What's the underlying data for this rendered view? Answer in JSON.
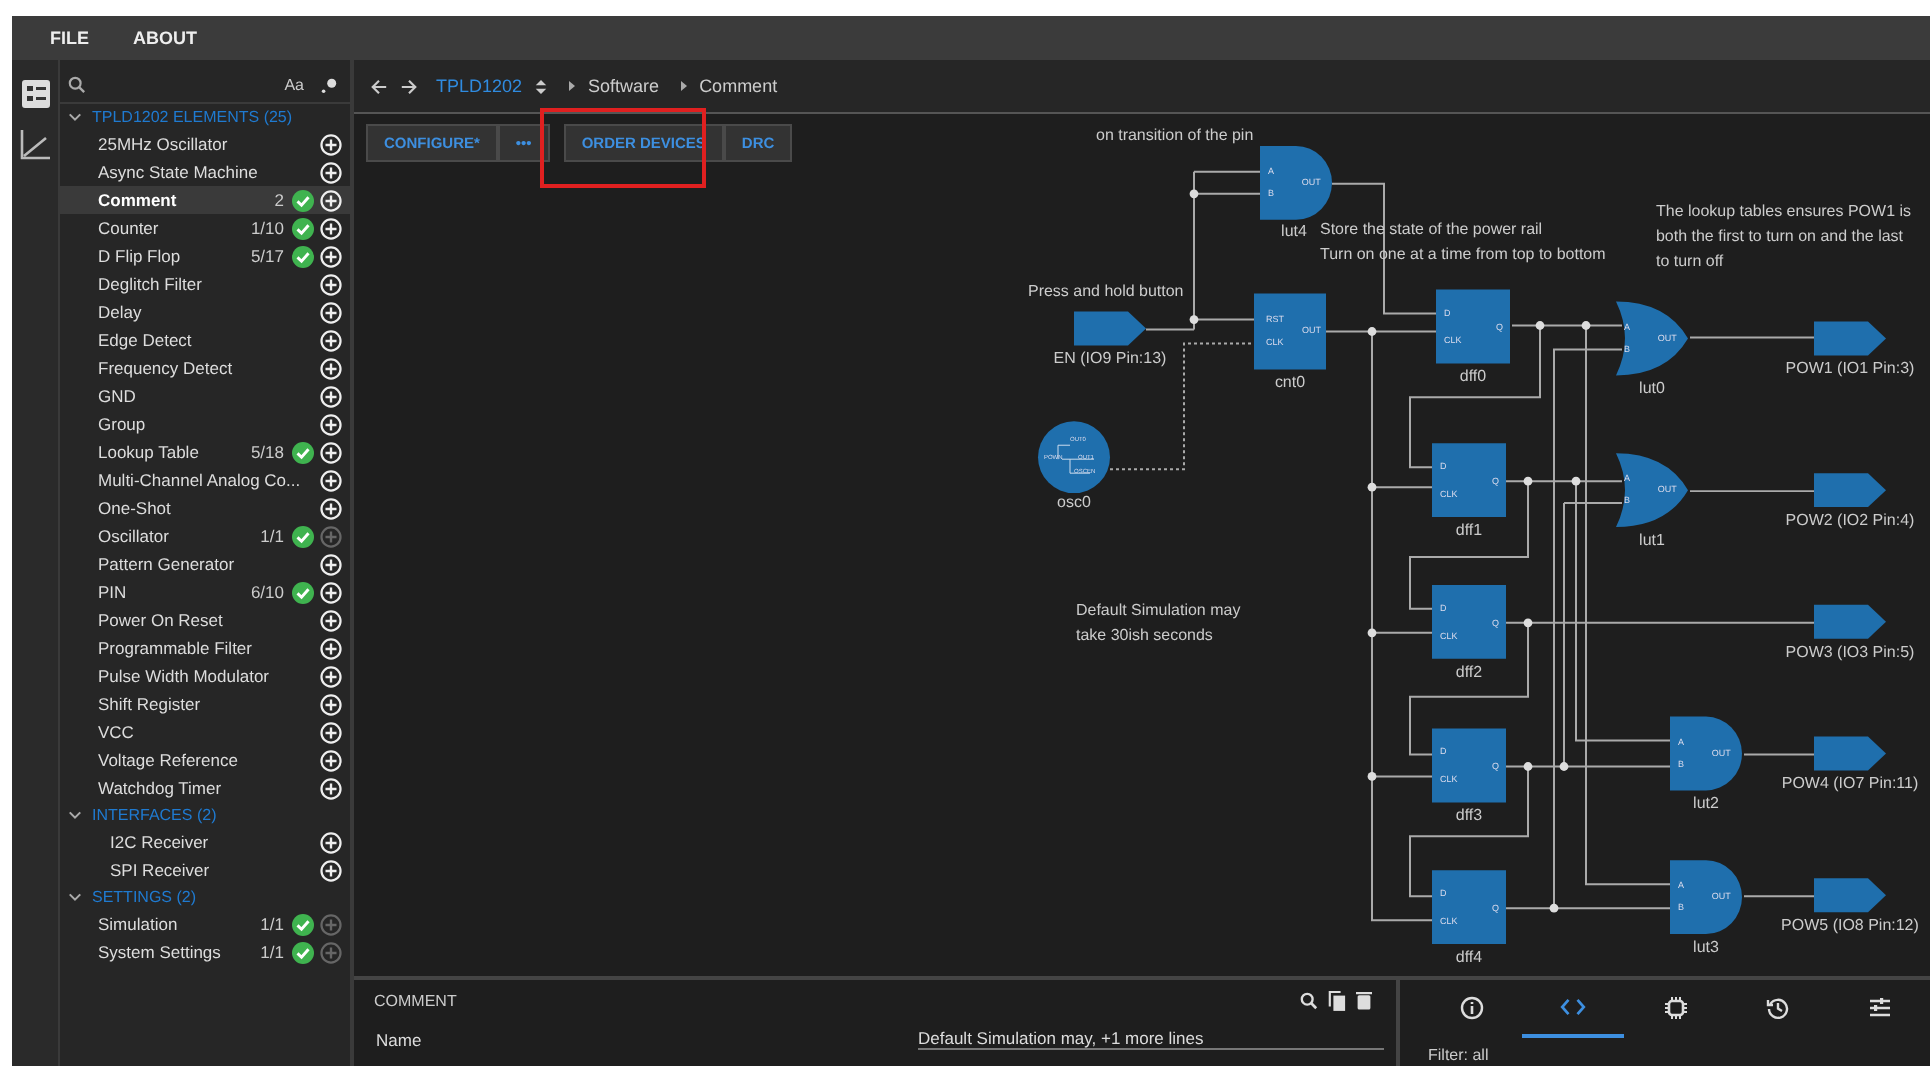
{
  "menu": [
    {
      "label": "FILE"
    },
    {
      "label": "ABOUT"
    }
  ],
  "activity_bar": [
    {
      "kind": "elements",
      "selected": true
    },
    {
      "kind": "chart",
      "selected": false
    }
  ],
  "sidebar": {
    "search": {
      "case_toggle": "Aa"
    },
    "sections": [
      {
        "title": "TPLD1202 ELEMENTS (25)",
        "expanded": true,
        "items": [
          {
            "label": "25MHz Oscillator",
            "done": false,
            "addable": true,
            "selected": false
          },
          {
            "label": "Async State Machine",
            "done": false,
            "addable": true,
            "selected": false
          },
          {
            "label": "Comment",
            "count": "2",
            "done": true,
            "addable": true,
            "selected": true
          },
          {
            "label": "Counter",
            "count": "1/10",
            "done": true,
            "addable": true,
            "selected": false
          },
          {
            "label": "D Flip Flop",
            "count": "5/17",
            "done": true,
            "addable": true,
            "selected": false
          },
          {
            "label": "Deglitch Filter",
            "done": false,
            "addable": true,
            "selected": false
          },
          {
            "label": "Delay",
            "done": false,
            "addable": true,
            "selected": false
          },
          {
            "label": "Edge Detect",
            "done": false,
            "addable": true,
            "selected": false
          },
          {
            "label": "Frequency Detect",
            "done": false,
            "addable": true,
            "selected": false
          },
          {
            "label": "GND",
            "done": false,
            "addable": true,
            "selected": false
          },
          {
            "label": "Group",
            "done": false,
            "addable": true,
            "selected": false
          },
          {
            "label": "Lookup Table",
            "count": "5/18",
            "done": true,
            "addable": true,
            "selected": false
          },
          {
            "label": "Multi-Channel Analog Co...",
            "done": false,
            "addable": true,
            "selected": false
          },
          {
            "label": "One-Shot",
            "done": false,
            "addable": true,
            "selected": false
          },
          {
            "label": "Oscillator",
            "count": "1/1",
            "done": true,
            "addable": false,
            "selected": false
          },
          {
            "label": "Pattern Generator",
            "done": false,
            "addable": true,
            "selected": false
          },
          {
            "label": "PIN",
            "count": "6/10",
            "done": true,
            "addable": true,
            "selected": false
          },
          {
            "label": "Power On Reset",
            "done": false,
            "addable": true,
            "selected": false
          },
          {
            "label": "Programmable Filter",
            "done": false,
            "addable": true,
            "selected": false
          },
          {
            "label": "Pulse Width Modulator",
            "done": false,
            "addable": true,
            "selected": false
          },
          {
            "label": "Shift Register",
            "done": false,
            "addable": true,
            "selected": false
          },
          {
            "label": "VCC",
            "done": false,
            "addable": true,
            "selected": false
          },
          {
            "label": "Voltage Reference",
            "done": false,
            "addable": true,
            "selected": false
          },
          {
            "label": "Watchdog Timer",
            "done": false,
            "addable": true,
            "selected": false
          }
        ]
      },
      {
        "title": "INTERFACES (2)",
        "expanded": true,
        "items": [
          {
            "label": "I2C Receiver",
            "done": false,
            "addable": true,
            "selected": false
          },
          {
            "label": "SPI Receiver",
            "done": false,
            "addable": true,
            "selected": false
          }
        ]
      },
      {
        "title": "SETTINGS (2)",
        "expanded": true,
        "items": [
          {
            "label": "Simulation",
            "count": "1/1",
            "done": true,
            "addable": false,
            "selected": false
          },
          {
            "label": "System Settings",
            "count": "1/1",
            "done": true,
            "addable": false,
            "selected": false
          }
        ]
      }
    ]
  },
  "breadcrumb": {
    "device": "TPLD1202",
    "path": [
      "Software",
      "Comment"
    ]
  },
  "toolbar": [
    [
      {
        "label": "CONFIGURE*"
      },
      {
        "label": "•••"
      }
    ],
    [
      {
        "label": "ORDER DEVICES"
      },
      {
        "label": "DRC"
      }
    ]
  ],
  "canvas": {
    "comments": [
      {
        "lines": [
          "on transition of the pin"
        ]
      },
      {
        "lines": [
          "Store the state of the power rail",
          "Turn on one at a time from top to bottom"
        ]
      },
      {
        "lines": [
          "The lookup tables ensures POW1 is",
          "both the first to turn on and the last",
          "to turn off"
        ]
      },
      {
        "lines": [
          "Press and hold button"
        ]
      },
      {
        "lines": [
          "Default Simulation may",
          "take 30ish seconds"
        ]
      }
    ],
    "nodes": [
      {
        "kind": "and",
        "label": "lut4",
        "pins": [
          "A",
          "B",
          "OUT"
        ]
      },
      {
        "kind": "pin_in",
        "label": "EN (IO9 Pin:13)"
      },
      {
        "kind": "counter",
        "label": "cnt0",
        "pins": [
          "RST",
          "CLK",
          "OUT"
        ]
      },
      {
        "kind": "osc",
        "label": "osc0",
        "pins": [
          "OUT0",
          "POWN",
          "OUT1",
          "OSCEN"
        ]
      },
      {
        "kind": "dff",
        "label": "dff0",
        "pins": [
          "D",
          "CLK",
          "Q"
        ]
      },
      {
        "kind": "dff",
        "label": "dff1",
        "pins": [
          "D",
          "CLK",
          "Q"
        ]
      },
      {
        "kind": "dff",
        "label": "dff2",
        "pins": [
          "D",
          "CLK",
          "Q"
        ]
      },
      {
        "kind": "dff",
        "label": "dff3",
        "pins": [
          "D",
          "CLK",
          "Q"
        ]
      },
      {
        "kind": "dff",
        "label": "dff4",
        "pins": [
          "D",
          "CLK",
          "Q"
        ]
      },
      {
        "kind": "or",
        "label": "lut0",
        "pins": [
          "A",
          "B",
          "OUT"
        ]
      },
      {
        "kind": "or",
        "label": "lut1",
        "pins": [
          "A",
          "B",
          "OUT"
        ]
      },
      {
        "kind": "and",
        "label": "lut2",
        "pins": [
          "A",
          "B",
          "OUT"
        ]
      },
      {
        "kind": "and",
        "label": "lut3",
        "pins": [
          "A",
          "B",
          "OUT"
        ]
      },
      {
        "kind": "pin_out",
        "label": "POW1 (IO1 Pin:3)"
      },
      {
        "kind": "pin_out",
        "label": "POW2 (IO2 Pin:4)"
      },
      {
        "kind": "pin_out",
        "label": "POW3 (IO3 Pin:5)"
      },
      {
        "kind": "pin_out",
        "label": "POW4 (IO7 Pin:11)"
      },
      {
        "kind": "pin_out",
        "label": "POW5 (IO8 Pin:12)"
      }
    ]
  },
  "comment_panel": {
    "title": "COMMENT",
    "field": {
      "label": "Name",
      "value": "Default Simulation may, +1 more lines"
    }
  },
  "inspector": {
    "tabs": [
      {
        "kind": "info",
        "selected": false
      },
      {
        "kind": "code",
        "selected": true
      },
      {
        "kind": "chip",
        "selected": false
      },
      {
        "kind": "history",
        "selected": false
      },
      {
        "kind": "settings",
        "selected": false
      }
    ],
    "filter": "Filter: all"
  }
}
